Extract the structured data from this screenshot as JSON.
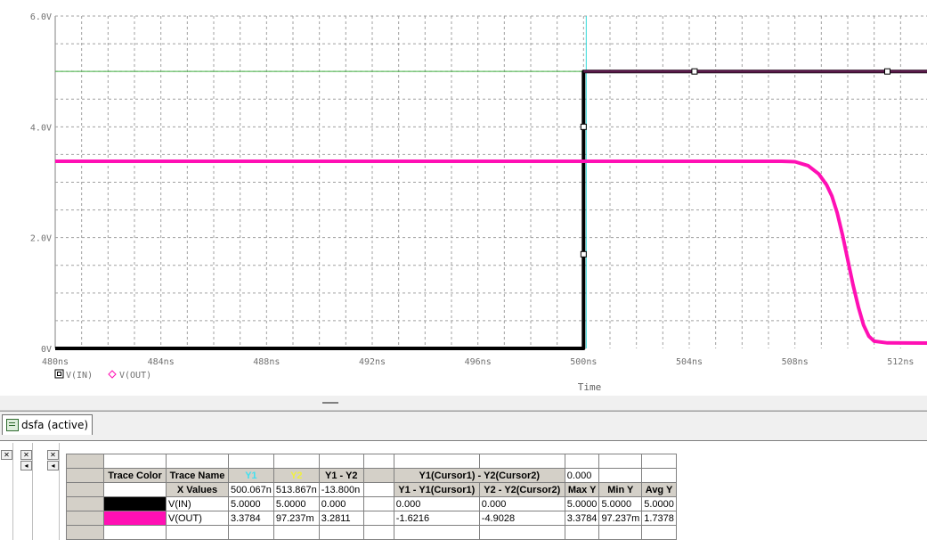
{
  "colors": {
    "vin": "#000000",
    "vout": "#ff10b4",
    "cursor1": "#30d8d8",
    "cursor2": "#40b040",
    "grid": "#a0a0a0",
    "y1_header": "#40e0f0",
    "y2_header": "#f0f040"
  },
  "chart_data": {
    "type": "line",
    "xlabel": "Time",
    "xlim": [
      480,
      513
    ],
    "ylim": [
      0,
      6
    ],
    "x_ticks": [
      {
        "v": 480,
        "label": "480ns"
      },
      {
        "v": 484,
        "label": "484ns"
      },
      {
        "v": 488,
        "label": "488ns"
      },
      {
        "v": 492,
        "label": "492ns"
      },
      {
        "v": 496,
        "label": "496ns"
      },
      {
        "v": 500,
        "label": "500ns"
      },
      {
        "v": 504,
        "label": "504ns"
      },
      {
        "v": 508,
        "label": "508ns"
      },
      {
        "v": 512,
        "label": "512ns"
      }
    ],
    "y_ticks": [
      {
        "v": 0,
        "label": "0V"
      },
      {
        "v": 2,
        "label": "2.0V"
      },
      {
        "v": 4,
        "label": "4.0V"
      },
      {
        "v": 6,
        "label": "6.0V"
      }
    ],
    "grid": true,
    "series": [
      {
        "name": "V(IN)",
        "marker": "square",
        "x": [
          480,
          500,
          500,
          513
        ],
        "y": [
          0,
          0,
          5,
          5
        ]
      },
      {
        "name": "V(OUT)",
        "marker": "diamond",
        "x": [
          480,
          507.5,
          508.0,
          508.5,
          508.9,
          509.2,
          509.4,
          509.6,
          509.8,
          510.0,
          510.2,
          510.4,
          510.6,
          510.8,
          511.0,
          511.5,
          513
        ],
        "y": [
          3.378,
          3.378,
          3.37,
          3.3,
          3.15,
          2.95,
          2.75,
          2.45,
          2.05,
          1.6,
          1.15,
          0.75,
          0.42,
          0.22,
          0.13,
          0.1,
          0.097
        ]
      }
    ],
    "cursor_x": 500.067,
    "cursor_y_level": 5.0
  },
  "tab": {
    "label": "dsfa (active)"
  },
  "table": {
    "h_trace_color": "Trace Color",
    "h_trace_name": "Trace Name",
    "h_y1": "Y1",
    "h_y2": "Y2",
    "h_y1y2": "Y1 - Y2",
    "h_cur_diff": "Y1(Cursor1) - Y2(Cursor2)",
    "h_cur_diff_val": "0.000",
    "x_values_label": "X Values",
    "x_y1": "500.067n",
    "x_y2": "513.867n",
    "x_diff": "-13.800n",
    "h_y1_c1": "Y1 - Y1(Cursor1)",
    "h_y2_c2": "Y2 - Y2(Cursor2)",
    "h_max": "Max Y",
    "h_min": "Min Y",
    "h_avg": "Avg Y",
    "rows": [
      {
        "name": "V(IN)",
        "y1": "5.0000",
        "y2": "5.0000",
        "d": "0.000",
        "c1": "0.000",
        "c2": "0.000",
        "max": "5.0000",
        "min": "5.0000",
        "avg": "5.0000"
      },
      {
        "name": "V(OUT)",
        "y1": "3.3784",
        "y2": "97.237m",
        "d": "3.2811",
        "c1": "-1.6216",
        "c2": "-4.9028",
        "max": "3.3784",
        "min": "97.237m",
        "avg": "1.7378"
      }
    ]
  }
}
